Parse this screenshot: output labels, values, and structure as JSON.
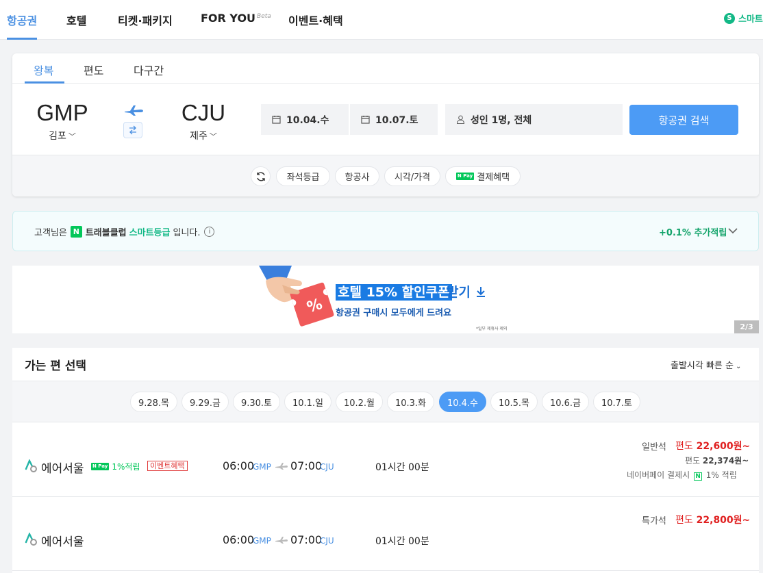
{
  "topnav": {
    "tabs": [
      "항공권",
      "호텔",
      "티켓·패키지",
      "FOR YOU",
      "이벤트·혜택"
    ],
    "beta": "Beta",
    "smart_icon": "S",
    "smart_label": "스마트"
  },
  "search": {
    "trip_tabs": [
      "왕복",
      "편도",
      "다구간"
    ],
    "origin": {
      "code": "GMP",
      "city": "김포"
    },
    "destination": {
      "code": "CJU",
      "city": "제주"
    },
    "depart_date": "10.04.수",
    "return_date": "10.07.토",
    "passengers": "성인 1명, 전체",
    "search_button": "항공권 검색",
    "filters": [
      "좌석등급",
      "항공사",
      "시각/가격",
      "결제혜택"
    ],
    "npay_badge": "N Pay"
  },
  "club": {
    "prefix": "고객님은",
    "n_logo": "N",
    "club_name": "트래블클럽",
    "grade": "스마트등급",
    "suffix": "입니다.",
    "info": "i",
    "points": "+0.1% 추가적립"
  },
  "promo": {
    "headline": "호텔 15% 할인쿠폰",
    "headline_suffix": "받기",
    "subline": "항공권 구매시 모두에게 드려요",
    "fine_print": "*일부 제휴사 제외",
    "coupon_symbol": "%",
    "pager": "2/3"
  },
  "results": {
    "title": "가는 편 선택",
    "sort": "출발시각 빠른 순",
    "dates": [
      "9.28.목",
      "9.29.금",
      "9.30.토",
      "10.1.일",
      "10.2.월",
      "10.3.화",
      "10.4.수",
      "10.5.목",
      "10.6.금",
      "10.7.토"
    ],
    "active_date_index": 6,
    "flights": [
      {
        "airline": "에어서울",
        "npay_badge": "N Pay",
        "npay_rate": "1%적립",
        "event": "이벤트혜택",
        "dep_time": "06:00",
        "dep_ap": "GMP",
        "arr_time": "07:00",
        "arr_ap": "CJU",
        "duration": "01시간 00분",
        "seat_class": "일반석",
        "price_prefix": "편도",
        "price": "22,600원~",
        "sub_price_prefix": "편도",
        "sub_price": "22,374원~",
        "pay_note_prefix": "네이버페이 결제시",
        "pay_note_n": "N",
        "pay_note_rate": "1% 적립"
      },
      {
        "airline": "에어서울",
        "dep_time": "06:00",
        "dep_ap": "GMP",
        "arr_time": "07:00",
        "arr_ap": "CJU",
        "duration": "01시간 00분",
        "seat_class": "특가석",
        "price_prefix": "편도",
        "price": "22,800원~"
      }
    ]
  },
  "colors": {
    "accent": "#4a90e2",
    "button": "#4c9bf5",
    "green": "#12b886",
    "price_red": "#e02020"
  }
}
